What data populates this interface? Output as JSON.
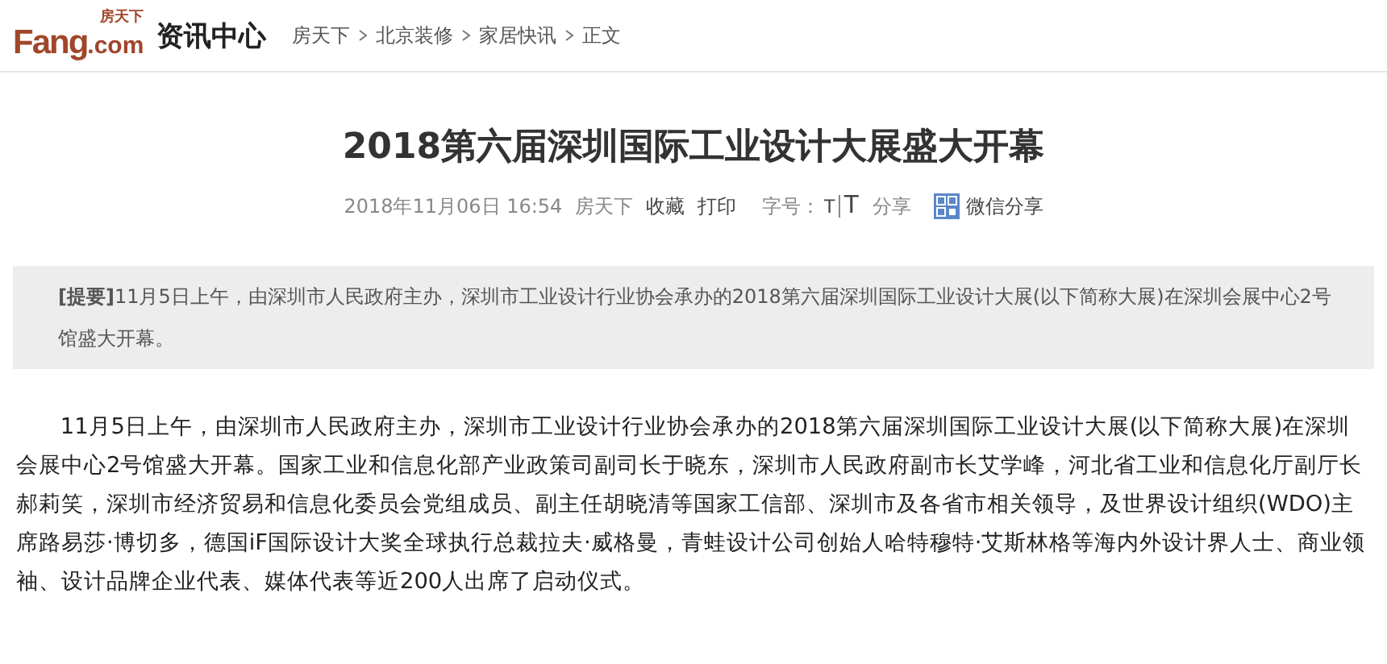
{
  "header": {
    "logo": {
      "top": "房天下",
      "main": "Fang",
      "suffix": ".com"
    },
    "section": "资讯中心",
    "breadcrumb": [
      "房天下",
      "北京装修",
      "家居快讯",
      "正文"
    ]
  },
  "article": {
    "title": "2018第六届深圳国际工业设计大展盛大开幕",
    "meta": {
      "datetime": "2018年11月06日 16:54",
      "source": "房天下",
      "actions": [
        "收藏",
        "打印"
      ],
      "font_label": "字号：",
      "font_sizes": [
        "T",
        "T"
      ],
      "share": "分享",
      "wechat_share": "微信分享"
    },
    "summary": "**[提要]**11月5日上午，由深圳市人民政府主办，深圳市工业设计行业协会承办的2018第六届深圳国际工业设计大展(以下简称大展)在深圳会展中心2号馆盛大开幕。",
    "paragraphs": [
      "11月5日上午，由深圳市人民政府主办，深圳市工业设计行业协会承办的2018第六届深圳国际工业设计大展(以下简称大展)在深圳会展中心2号馆盛大开幕。国家工业和信息化部产业政策司副司长于晓东，深圳市人民政府副市长艾学峰，河北省工业和信息化厅副厅长郝莉笑，深圳市经济贸易和信息化委员会党组成员、副主任胡晓清等国家工信部、深圳市及各省市相关领导，及世界设计组织(WDO)主席路易莎·博切多，德国iF国际设计大奖全球执行总裁拉夫·威格曼，青蛙设计公司创始人哈特穆特·艾斯林格等海内外设计界人士、商业领袖、设计品牌企业代表、媒体代表等近200人出席了启动仪式。"
    ]
  }
}
